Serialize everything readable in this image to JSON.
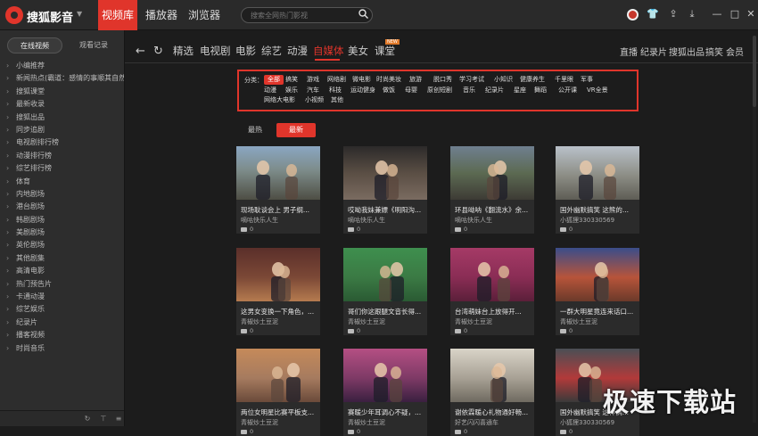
{
  "app": {
    "name": "搜狐影音"
  },
  "nav_tabs": [
    "视频库",
    "播放器",
    "浏览器"
  ],
  "search": {
    "placeholder": "搜索全网热门影视"
  },
  "window_icons": [
    "avatar-icon",
    "shirt-icon",
    "upload-icon",
    "download-icon",
    "minimize-icon",
    "maximize-icon",
    "close-icon"
  ],
  "sidebar": {
    "tab_online": "在线视频",
    "tab_history": "观看记录",
    "items": [
      "小编推荐",
      "新闻热点(霸道：感情的事顺其自然...",
      "搜狐课堂",
      "最新收录",
      "搜狐出品",
      "同步追剧",
      "电视剧排行榜",
      "动漫排行榜",
      "综艺排行榜",
      "体育",
      "内地剧场",
      "港台剧场",
      "韩剧剧场",
      "美剧剧场",
      "英伦剧场",
      "其他剧集",
      "高清电影",
      "热门预告片",
      "卡通动漫",
      "综艺娱乐",
      "纪录片",
      "播客视频",
      "时尚音乐"
    ]
  },
  "categories": {
    "left": [
      "精选",
      "电视剧",
      "电影",
      "综艺",
      "动漫",
      "自媒体",
      "美女",
      "课堂"
    ],
    "active": "自媒体",
    "new_badge": "NEW",
    "right": [
      "直播",
      "纪录片",
      "搜狐出品",
      "搞笑",
      "会员"
    ]
  },
  "filter": {
    "label": "分类：",
    "rows": [
      [
        "全部",
        "搞笑",
        "游戏",
        "网络剧",
        "微电影",
        "时尚美妆",
        "旅游",
        "脱口秀",
        "学习考试",
        "小知识",
        "健康养生",
        "千里眼",
        "军事"
      ],
      [
        "动漫",
        "娱乐",
        "汽车",
        "科技",
        "运动健身",
        "做饭",
        "母婴",
        "原创短剧",
        "音乐",
        "纪录片",
        "星座",
        "舞蹈",
        "公开课",
        "VR全景"
      ],
      [
        "网络大电影",
        "小视频",
        "其他"
      ]
    ],
    "selected": "全部"
  },
  "sort": {
    "hot": "最热",
    "new": "最新"
  },
  "videos": [
    {
      "title": "现场耿谈会上 男子纲...",
      "source": "嘀咕快乐人生",
      "count": "0"
    },
    {
      "title": "哎呦我妹兼嫖《明阳沟...",
      "source": "嘀咕快乐人生",
      "count": "0"
    },
    {
      "title": "环县呦呐《翻流水》余...",
      "source": "嘀咕快乐人生",
      "count": "0"
    },
    {
      "title": "国外幽默搞笑 这熊的...",
      "source": "小狐狸330330569",
      "count": "0"
    },
    {
      "title": "这男女变换一下角色，...",
      "source": "青椒炒土豆泥",
      "count": "0"
    },
    {
      "title": "哥们你这跟腿文音长得...",
      "source": "青椒炒土豆泥",
      "count": "0"
    },
    {
      "title": "台湾萌妹台上放得开...",
      "source": "青椒炒土豆泥",
      "count": "0"
    },
    {
      "title": "一群大明星竟连来话口...",
      "source": "青椒炒土豆泥",
      "count": "0"
    },
    {
      "title": "两位女明星比赛平板支...",
      "source": "青椒炒土豆泥",
      "count": "0"
    },
    {
      "title": "赛暖少年耳调心不疑，...",
      "source": "青椒炒土豆泥",
      "count": "0"
    },
    {
      "title": "谢依霖暖心礼物通好畅...",
      "source": "好艺闪闪喜通车",
      "count": "0"
    },
    {
      "title": "国外幽默搞笑 这样俩...",
      "source": "小狐狸330330569",
      "count": "0"
    }
  ],
  "watermark": "极速下载站",
  "colors": {
    "accent": "#e0352b",
    "background": "#1c1c1c",
    "sidebar": "#2d2d2d"
  }
}
